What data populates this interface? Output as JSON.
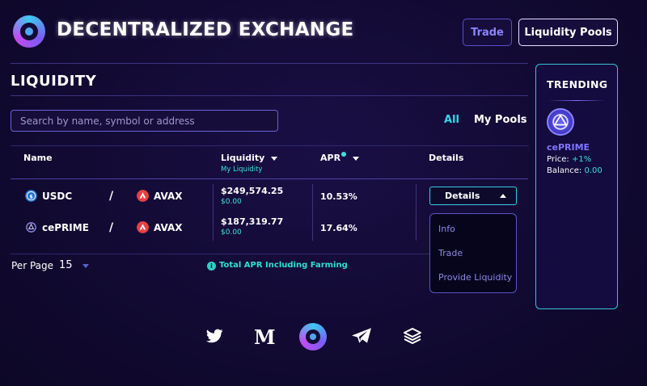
{
  "header": {
    "brand": "DECENTRALIZED EXCHANGE",
    "nav": [
      {
        "label": "Trade"
      },
      {
        "label": "Liquidity Pools"
      }
    ]
  },
  "liquidity": {
    "title": "LIQUIDITY",
    "search_placeholder": "Search by name, symbol or address",
    "filters": {
      "all": "All",
      "my_pools": "My Pools"
    },
    "columns": {
      "name": "Name",
      "liquidity": "Liquidity",
      "liquidity_sub": "My Liquidity",
      "apr": "APR",
      "details": "Details"
    },
    "rows": [
      {
        "token_a": "USDC",
        "token_b": "AVAX",
        "liquidity": "$249,574.25",
        "my_liquidity": "$0.00",
        "apr": "10.53%"
      },
      {
        "token_a": "cePRIME",
        "token_b": "AVAX",
        "liquidity": "$187,319.77",
        "my_liquidity": "$0.00",
        "apr": "17.64%"
      }
    ],
    "pair_separator": "/",
    "details_button": "Details",
    "details_menu": [
      "Info",
      "Trade",
      "Provide Liquidity"
    ],
    "per_page_label": "Per Page",
    "per_page_value": "15",
    "total_apr_note": "Total APR Including Farming"
  },
  "trending": {
    "title": "TRENDING",
    "token": "cePRIME",
    "price_label": "Price:",
    "price_value": "+1%",
    "balance_label": "Balance:",
    "balance_value": "0.00"
  },
  "footer": {
    "icons": [
      "twitter-icon",
      "medium-icon",
      "logo-icon",
      "telegram-icon",
      "docs-stack-icon"
    ],
    "medium_glyph": "M"
  },
  "colors": {
    "background": "#120a33",
    "accent_cyan": "#38d6ea",
    "accent_purple": "#8b83ff",
    "usdc_blue": "#2775ca",
    "avax_red": "#e84142"
  }
}
